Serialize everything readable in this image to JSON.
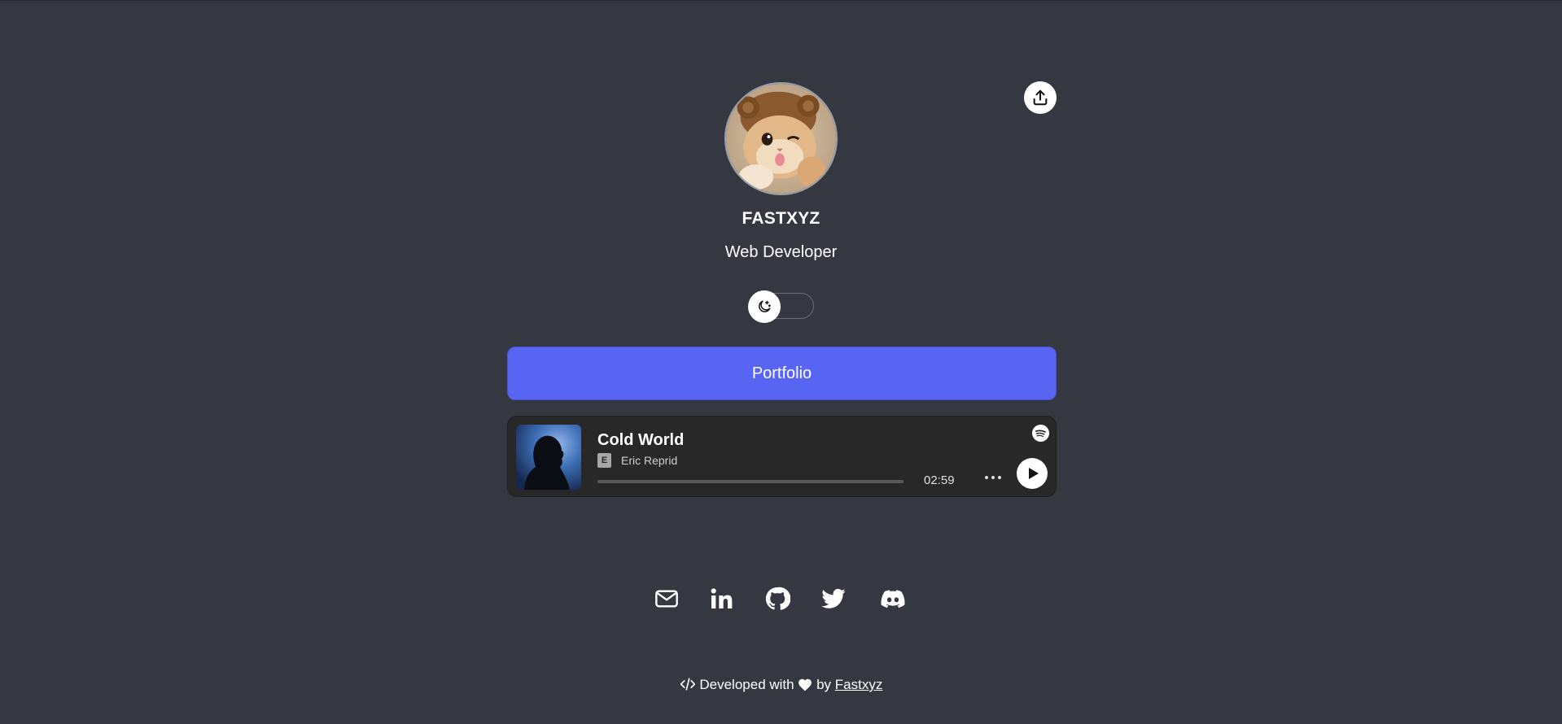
{
  "profile": {
    "name": "FASTXYZ",
    "role": "Web Developer",
    "avatar_icon": "cat-avatar"
  },
  "share": {
    "icon": "share-upload-icon"
  },
  "theme_toggle": {
    "icon": "moon-stars-icon",
    "state": "dark"
  },
  "links": [
    {
      "label": "Portfolio",
      "color": "#5865f2"
    }
  ],
  "player": {
    "track_title": "Cold World",
    "explicit_badge": "E",
    "artist": "Eric Reprid",
    "duration": "02:59",
    "progress": 0,
    "icons": [
      "spotify-icon",
      "more-icon",
      "play-icon"
    ]
  },
  "socials": [
    {
      "name": "email",
      "icon": "mail-icon"
    },
    {
      "name": "linkedin",
      "icon": "linkedin-icon"
    },
    {
      "name": "github",
      "icon": "github-icon"
    },
    {
      "name": "twitter",
      "icon": "twitter-icon"
    },
    {
      "name": "discord",
      "icon": "discord-icon"
    }
  ],
  "footer": {
    "prefix": "Developed with",
    "middle": "by",
    "author_link": "Fastxyz"
  },
  "colors": {
    "background": "#353841",
    "accent": "#5865f2",
    "player_bg": "#282828"
  }
}
